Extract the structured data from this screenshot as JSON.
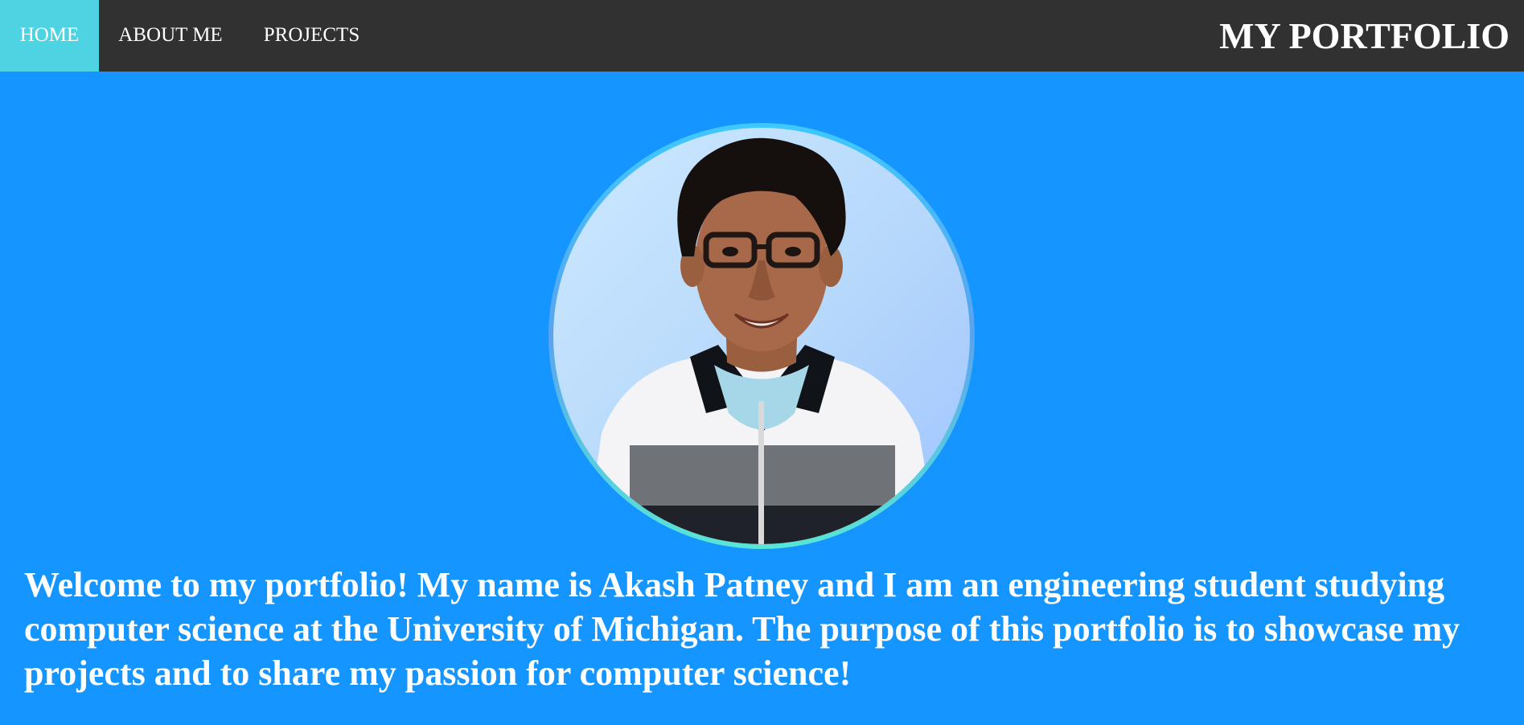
{
  "nav": {
    "items": [
      {
        "label": "HOME",
        "active": true
      },
      {
        "label": "ABOUT ME",
        "active": false
      },
      {
        "label": "PROJECTS",
        "active": false
      }
    ],
    "brand": "MY PORTFOLIO"
  },
  "hero": {
    "photo_icon": "profile-photo",
    "welcome_text": "Welcome to my portfolio! My name is Akash Patney and I am an engineering student studying computer science at the University of Michigan. The purpose of this portfolio is to showcase my projects and to share my passion for computer science!"
  },
  "colors": {
    "page_background": "#1595ff",
    "navbar_background": "#323132",
    "nav_active": "#4dd3e2",
    "text": "#ffffff"
  }
}
